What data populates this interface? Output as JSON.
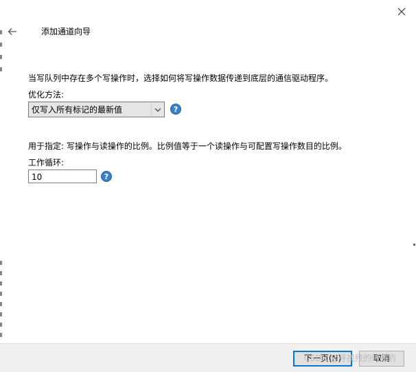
{
  "wizard": {
    "title": "添加通道向导"
  },
  "content": {
    "description": "当写队列中存在多个写操作时，选择如何将写操作数据传递到底层的通信驱动程序。",
    "optimization": {
      "label": "优化方法:",
      "selected": "仅写入所有标记的最新值"
    },
    "ratio_description": "用于指定: 写操作与读操作的比例。比例值等于一个读操作与可配置写操作数目的比例。",
    "duty_cycle": {
      "label": "工作循环:",
      "value": "10"
    }
  },
  "footer": {
    "next_label": "下一页(N)",
    "cancel_label": "取消"
  },
  "watermark": "CSDN @寻找残的烤海豹",
  "icons": {
    "close": "close-icon",
    "back": "back-arrow-icon",
    "dropdown": "chevron-down-icon",
    "help": "help-icon"
  },
  "colors": {
    "accent": "#0078d7",
    "help_icon": "#3a7fc7"
  }
}
